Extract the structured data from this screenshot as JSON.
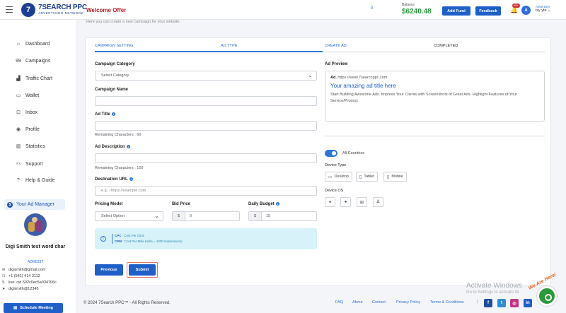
{
  "header": {
    "logo_name": "7SEARCH PPC",
    "logo_tagline": "ADVERTISING NETWORK",
    "welcome": "Welcome Offer",
    "dot": "0",
    "balance_label": "Balance",
    "balance_value": "$6240.48",
    "add_fund": "Add Fund",
    "feedback": "Feedback",
    "notification_count": "99+",
    "avatar_letter": "A",
    "user_role": "Advertiser",
    "user_name": "isy yte"
  },
  "sidebar": {
    "items": [
      {
        "label": "Dashboard",
        "icon": "home-icon"
      },
      {
        "label": "Campaigns",
        "icon": "campaign-icon"
      },
      {
        "label": "Traffic Chart",
        "icon": "chart-icon"
      },
      {
        "label": "Wallet",
        "icon": "wallet-icon"
      },
      {
        "label": "Inbox",
        "icon": "inbox-icon"
      },
      {
        "label": "Profile",
        "icon": "profile-icon"
      },
      {
        "label": "Statistics",
        "icon": "statistics-icon"
      },
      {
        "label": "Support",
        "icon": "support-icon"
      },
      {
        "label": "Help & Guide",
        "icon": "help-icon"
      }
    ],
    "ad_manager": "Your Ad Manager",
    "ad_manager_icon_letter": "$",
    "profile_name": "Digi Smith test word char",
    "profile_id": "ADM5337",
    "email": "digismith@gmail.com",
    "phone": "+1 (541) 414 3112",
    "skype": "live:.cid.502c0ec5a034706c",
    "telegram": "digismith@12345",
    "schedule": "Schedule Meeting"
  },
  "main": {
    "subtitle": "Here you can create a new campaign for your website.",
    "steps": [
      "CAMPAIGN SETTING",
      "AD TYPE",
      "CREATE AD",
      "COMPLETED"
    ],
    "campaign_category_label": "Campaign Category",
    "campaign_category_value": "Select Category",
    "campaign_name_label": "Campaign Name",
    "campaign_name_value": "",
    "ad_title_label": "Ad Title",
    "ad_title_value": "",
    "ad_title_remaining": "Remaining Characters : 60",
    "ad_description_label": "Ad Description",
    "ad_description_value": "",
    "ad_description_remaining": "Remaining Characters : 150",
    "destination_url_label": "Destination URL",
    "destination_url_placeholder": "e.g. - https://example.com",
    "pricing_model_label": "Pricing Model",
    "pricing_model_value": "Select Option",
    "bid_price_label": "Bid Price",
    "bid_price_prefix": "$",
    "bid_price_value": "0",
    "daily_budget_label": "Daily Budget",
    "daily_budget_prefix": "$",
    "daily_budget_value": "15",
    "cpc_abbr": "CPC",
    "cpc_text": " : Cost Per Click",
    "cpm_abbr": "CPM",
    "cpm_text": " : Cost Per Mille (mille = 1000 impressions)",
    "previous": "Previous",
    "submit": "Submit"
  },
  "preview": {
    "label": "Ad Preview",
    "ad_tag": "Ad.",
    "url": " https://www.7searchppc.com",
    "title": "Your amazing ad title here",
    "description": "Start Building Awesome Ads. Impress Your Clients with Screenshots of Great Ads. Highlight Features of Your Service/Product"
  },
  "targeting": {
    "countries": "All Countries",
    "device_label": "Device Type",
    "devices": [
      "Desktop",
      "Tablet",
      "Mobile"
    ],
    "os_label": "Device OS",
    "os": [
      "android-icon",
      "apple-icon",
      "windows-icon",
      "linux-icon"
    ]
  },
  "footer": {
    "copyright": "© 2024 7Search PPC™ - All Rights Reserved.",
    "links": [
      "FAQ",
      "About",
      "Contact",
      "Privacy Policy",
      "Terms & Conditions"
    ],
    "activate_title": "Activate Windows",
    "activate_sub": "Go to Settings to activate W",
    "chat_badge": "We Are Here!"
  }
}
